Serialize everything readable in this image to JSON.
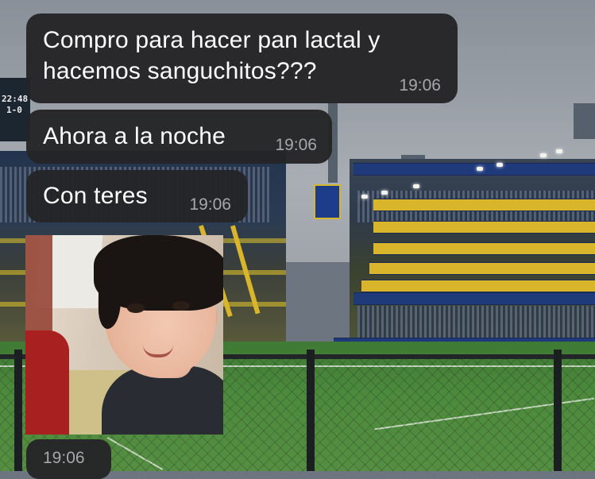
{
  "chat": {
    "messages": [
      {
        "line1": "Compro para hacer pan lactal y",
        "line2": "hacemos sanguchitos???",
        "time": "19:06"
      },
      {
        "text": "Ahora a la noche",
        "time": "19:06"
      },
      {
        "text": "Con teres",
        "time": "19:06"
      },
      {
        "type": "photo",
        "subject": "smiling-boy-photo",
        "time": "19:06"
      }
    ]
  },
  "wallpaper": {
    "scoreboard_time": "22:48",
    "scoreboard_score": "1-0",
    "colors": {
      "sky": "#9aa0a7",
      "pitch": "#4c8a3c",
      "stand_yellow": "#d8b52a",
      "stand_blue": "#1f3a7a"
    }
  },
  "colors": {
    "bubble": "#242426",
    "text": "#ffffff",
    "timestamp": "#a7a7ab"
  }
}
